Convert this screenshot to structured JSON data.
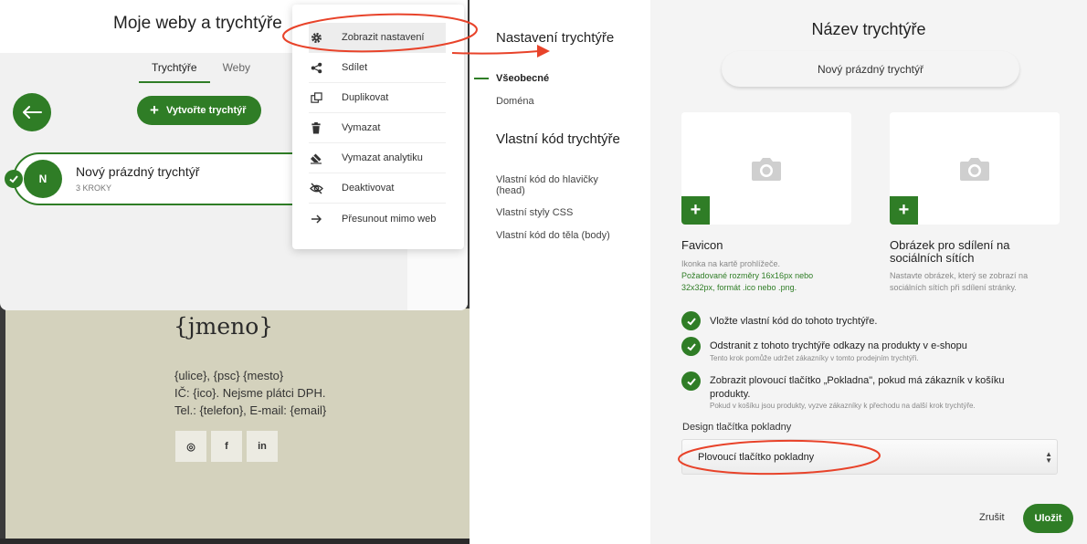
{
  "footer": {
    "brand": "{jmeno}",
    "address_line1": "{ulice}, {psc} {mesto}",
    "address_line2": "IČ: {ico}. Nejsme plátci DPH.",
    "address_line3": "Tel.: {telefon}, E-mail: {email}",
    "social": [
      {
        "icon": "instagram-icon",
        "glyph": "◎"
      },
      {
        "icon": "facebook-icon",
        "glyph": "f"
      },
      {
        "icon": "linkedin-icon",
        "glyph": "in"
      }
    ]
  },
  "funnels": {
    "title": "Moje weby a trychtýře",
    "tabs": [
      "Trychtýře",
      "Weby"
    ],
    "active_tab": 0,
    "create_button": "Vytvořte trychtýř",
    "funnel": {
      "initial": "N",
      "name": "Nový prázdný trychtýř",
      "steps": "3 KROKY"
    }
  },
  "menu": {
    "items": [
      {
        "label": "Zobrazit nastavení",
        "icon": "gear-icon"
      },
      {
        "label": "Sdílet",
        "icon": "share-icon"
      },
      {
        "label": "Duplikovat",
        "icon": "duplicate-icon"
      },
      {
        "label": "Vymazat",
        "icon": "trash-icon"
      },
      {
        "label": "Vymazat analytiku",
        "icon": "eraser-icon"
      },
      {
        "label": "Deaktivovat",
        "icon": "eye-off-icon"
      },
      {
        "label": "Přesunout mimo web",
        "icon": "arrow-right-icon"
      }
    ],
    "highlighted": 0
  },
  "settings_nav": {
    "heading1": "Nastavení trychtýře",
    "general": "Všeobecné",
    "domain": "Doména",
    "heading2": "Vlastní kód trychtýře",
    "head_code": "Vlastní kód do hlavičky (head)",
    "css": "Vlastní styly CSS",
    "body_code": "Vlastní kód do těla (body)"
  },
  "form": {
    "title": "Název trychtýře",
    "name_value": "Nový prázdný trychtýř",
    "favicon": {
      "title": "Favicon",
      "desc": "Ikonka na kartě prohlížeče.",
      "req": "Požadované rozměry 16x16px nebo 32x32px, formát .ico nebo .png."
    },
    "share_image": {
      "title": "Obrázek pro sdílení na sociálních sítích",
      "desc": "Nastavte obrázek, který se zobrazí na sociálních sítích při sdílení stránky."
    },
    "checks": [
      {
        "label": "Vložte vlastní kód do tohoto trychtýře.",
        "sub": ""
      },
      {
        "label": "Odstranit z tohoto trychtýře odkazy na produkty v e-shopu",
        "sub": "Tento krok pomůže udržet zákazníky v tomto prodejním trychtýři."
      },
      {
        "label": "Zobrazit plovoucí tlačítko „Pokladna\", pokud má zákazník v košíku produkty.",
        "sub": "Pokud v košíku jsou produkty, vyzve zákazníky k přechodu na další krok trychtýře."
      }
    ],
    "select_label": "Design tlačítka pokladny",
    "select_value": "Plovoucí tlačítko pokladny",
    "cancel": "Zrušit",
    "save": "Uložit"
  },
  "colors": {
    "accent": "#2f7d26",
    "annotation": "#e8432a"
  }
}
